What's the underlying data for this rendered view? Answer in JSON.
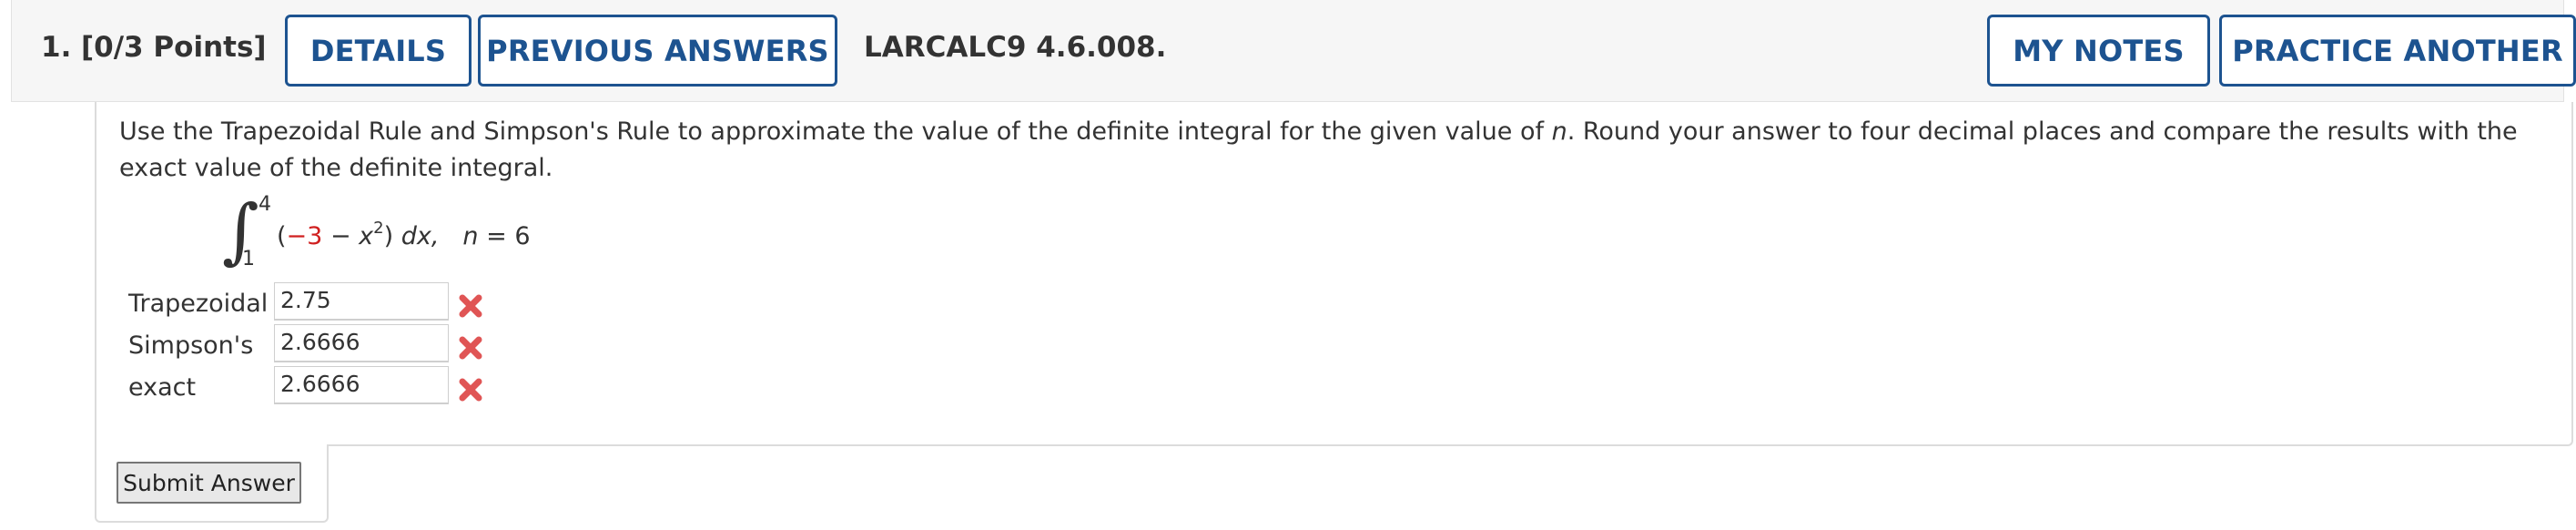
{
  "header": {
    "question_number": "1.",
    "points": "[0/3 Points]",
    "details_label": "DETAILS",
    "previous_answers_label": "PREVIOUS ANSWERS",
    "course_code": "LARCALC9 4.6.008.",
    "my_notes_label": "MY NOTES",
    "practice_another_label": "PRACTICE ANOTHER"
  },
  "question": {
    "prompt_before_n": "Use the Trapezoidal Rule and Simpson's Rule to approximate the value of the definite integral for the given value of ",
    "prompt_n": "n",
    "prompt_after_n": ". Round your answer to four decimal places and compare the results with the exact value of the definite integral.",
    "integral": {
      "upper_limit": "4",
      "lower_limit": "1",
      "open_paren": "(",
      "constant": "−3",
      "minus": " − ",
      "variable": "x",
      "exponent": "2",
      "close": ") ",
      "dx": "dx,",
      "n_label": "n",
      "n_value": " = 6"
    }
  },
  "answers": [
    {
      "label": "Trapezoidal",
      "value": "2.75",
      "status": "incorrect"
    },
    {
      "label": "Simpson's",
      "value": "2.6666",
      "status": "incorrect"
    },
    {
      "label": "exact",
      "value": "2.6666",
      "status": "incorrect"
    }
  ],
  "submit_label": "Submit Answer",
  "colors": {
    "accent": "#1d5390",
    "incorrect": "#e05555",
    "highlight_red": "#d02020"
  }
}
